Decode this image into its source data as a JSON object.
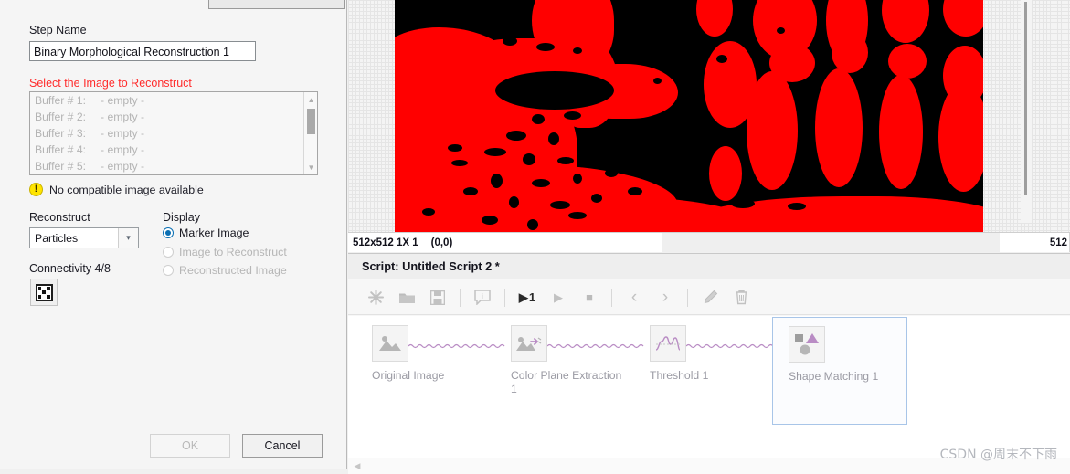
{
  "dialog": {
    "step_name_label": "Step Name",
    "step_name_value": "Binary Morphological Reconstruction 1",
    "select_image_label": "Select the Image to Reconstruct",
    "buffers": [
      {
        "num": "Buffer # 1:",
        "state": "- empty -"
      },
      {
        "num": "Buffer # 2:",
        "state": "- empty -"
      },
      {
        "num": "Buffer # 3:",
        "state": "- empty -"
      },
      {
        "num": "Buffer # 4:",
        "state": "- empty -"
      },
      {
        "num": "Buffer # 5:",
        "state": "- empty -"
      }
    ],
    "warning_icon": "warning-exclamation-icon",
    "warning_text": "No compatible image available",
    "reconstruct_label": "Reconstruct",
    "reconstruct_value": "Particles",
    "connectivity_label": "Connectivity 4/8",
    "connectivity_icon": "connectivity-grid-icon",
    "display_label": "Display",
    "display_options": [
      {
        "label": "Marker Image",
        "selected": true,
        "enabled": true
      },
      {
        "label": "Image to Reconstruct",
        "selected": false,
        "enabled": false
      },
      {
        "label": "Reconstructed Image",
        "selected": false,
        "enabled": false
      }
    ],
    "ok_label": "OK",
    "cancel_label": "Cancel",
    "error_color": "#ff2d2d",
    "accent_color": "#0a6fb3"
  },
  "viewer": {
    "status_size": "512x512 1X 1",
    "status_coords": "(0,0)",
    "status_right": "512",
    "image_fg_color": "#ff0000",
    "image_bg_color": "#000000"
  },
  "script": {
    "title": "Script: Untitled Script 2 *",
    "toolbar": [
      {
        "name": "new-script-icon",
        "glyph": "✳"
      },
      {
        "name": "open-script-icon",
        "glyph": "folder"
      },
      {
        "name": "save-script-icon",
        "glyph": "save"
      },
      {
        "name": "comment-icon",
        "glyph": "comment"
      },
      {
        "name": "run-once-icon",
        "glyph": "run1"
      },
      {
        "name": "run-icon",
        "glyph": "▶"
      },
      {
        "name": "stop-icon",
        "glyph": "■"
      },
      {
        "name": "previous-step-icon",
        "glyph": "‹"
      },
      {
        "name": "next-step-icon",
        "glyph": "›"
      },
      {
        "name": "edit-step-icon",
        "glyph": "pencil"
      },
      {
        "name": "delete-step-icon",
        "glyph": "trash"
      }
    ],
    "steps": [
      {
        "caption": "Original Image",
        "icon": "image-mountain-icon",
        "selected": false
      },
      {
        "caption": "Color Plane Extraction 1",
        "icon": "color-plane-extraction-icon",
        "selected": false
      },
      {
        "caption": "Threshold 1",
        "icon": "histogram-threshold-icon",
        "selected": false
      },
      {
        "caption": "Shape Matching 1",
        "icon": "shape-matching-icon",
        "selected": true
      }
    ],
    "connector_color": "#b98cc4",
    "selection_border_color": "#a8c5e8"
  },
  "watermark": "CSDN @周末不下雨"
}
